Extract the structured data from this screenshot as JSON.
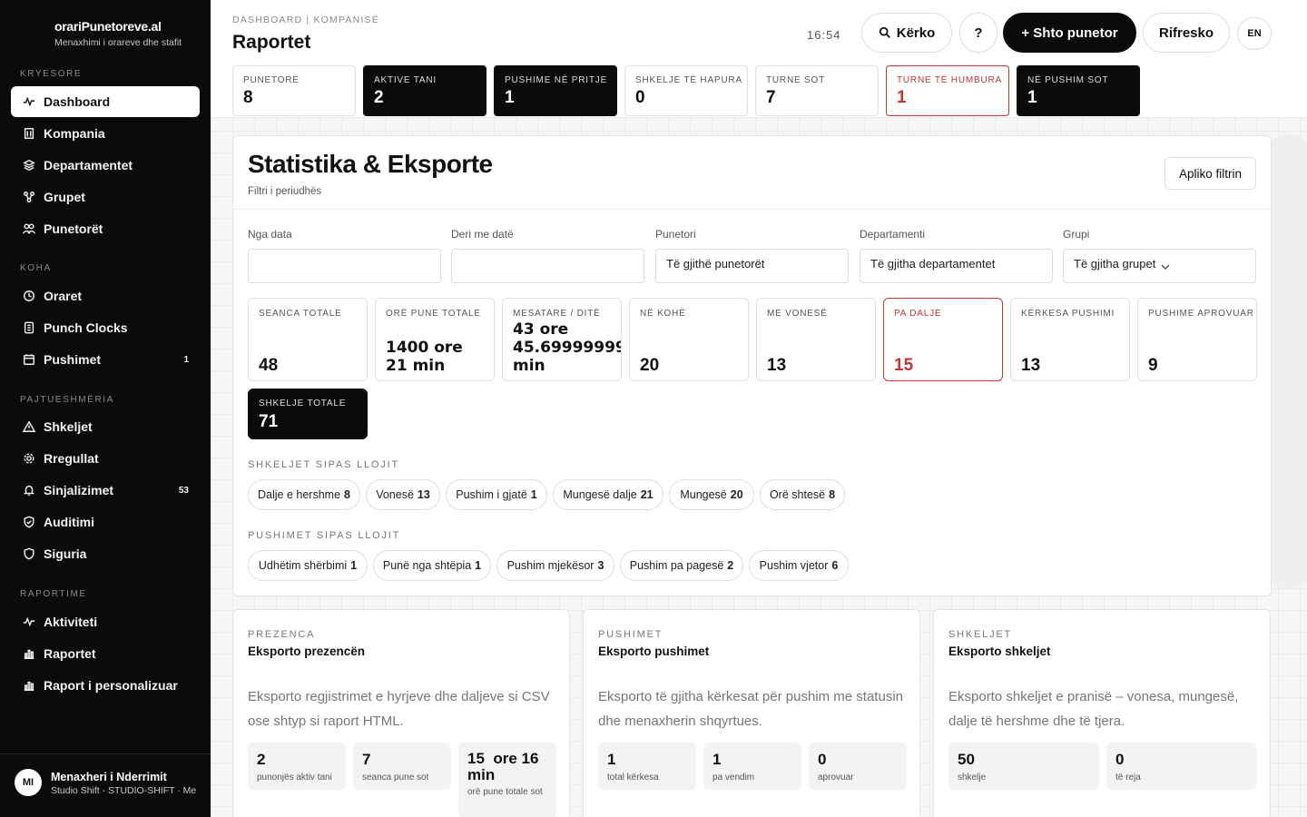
{
  "sidebar": {
    "brand": {
      "title": "orariPunetoreve.al",
      "subtitle": "Menaxhimi i orareve dhe stafit"
    },
    "sections": [
      {
        "label": "KRYESORE",
        "items": [
          {
            "label": "Dashboard",
            "icon": "activity-icon",
            "active": true
          },
          {
            "label": "Kompania",
            "icon": "building-icon"
          },
          {
            "label": "Departamentet",
            "icon": "layers-icon"
          },
          {
            "label": "Grupet",
            "icon": "group-icon"
          },
          {
            "label": "Punetorët",
            "icon": "users-icon"
          }
        ]
      },
      {
        "label": "KOHA",
        "items": [
          {
            "label": "Oraret",
            "icon": "clock-icon"
          },
          {
            "label": "Punch Clocks",
            "icon": "device-icon"
          },
          {
            "label": "Pushimet",
            "icon": "calendar-icon",
            "badge": "1"
          }
        ]
      },
      {
        "label": "PAJTUESHMËRIA",
        "items": [
          {
            "label": "Shkeljet",
            "icon": "warning-icon"
          },
          {
            "label": "Rregullat",
            "icon": "gear-icon"
          },
          {
            "label": "Sinjalizimet",
            "icon": "bell-icon",
            "badge": "53"
          },
          {
            "label": "Auditimi",
            "icon": "shield-icon"
          },
          {
            "label": "Siguria",
            "icon": "shield-lock-icon"
          }
        ]
      },
      {
        "label": "RAPORTIME",
        "items": [
          {
            "label": "Aktiviteti",
            "icon": "activity-icon"
          },
          {
            "label": "Raportet",
            "icon": "bar-chart-icon"
          },
          {
            "label": "Raport i personalizuar",
            "icon": "bar-chart-icon"
          }
        ]
      }
    ],
    "user": {
      "initials": "MI",
      "name": "Menaxheri i Nderrimit",
      "org": "Studio Shift - STUDIO-SHIFT · Me"
    }
  },
  "header": {
    "breadcrumb": "DASHBOARD  |  KOMPANISË",
    "title": "Raportet",
    "clock": "16:54",
    "search_label": "Kërko",
    "help_label": "?",
    "add_label": "+ Shto punetor",
    "refresh_label": "Rifresko",
    "lang_label": "EN"
  },
  "kpis": [
    {
      "label": "PUNETORE",
      "value": "8",
      "style": "light"
    },
    {
      "label": "AKTIVE TANI",
      "value": "2",
      "style": "dark"
    },
    {
      "label": "PUSHIME NË PRITJE",
      "value": "1",
      "style": "dark"
    },
    {
      "label": "SHKELJE TË HAPURA",
      "value": "0",
      "style": "light"
    },
    {
      "label": "TURNE SOT",
      "value": "7",
      "style": "light"
    },
    {
      "label": "TURNE TË HUMBURA",
      "value": "1",
      "style": "red"
    },
    {
      "label": "NË PUSHIM SOT",
      "value": "1",
      "style": "dark"
    }
  ],
  "stats_panel": {
    "title": "Statistika & Eksporte",
    "subtitle": "Filtri i periudhës",
    "apply_label": "Apliko filtrin",
    "filters": [
      {
        "label": "Nga data",
        "value": ""
      },
      {
        "label": "Deri me datë",
        "value": ""
      },
      {
        "label": "Punetori",
        "value": "Të gjithë punetorët"
      },
      {
        "label": "Departamenti",
        "value": "Të gjitha departamentet"
      },
      {
        "label": "Grupi",
        "value": "Të gjitha grupet"
      }
    ],
    "stats": [
      {
        "label": "SEANCA TOTALE",
        "value": "48"
      },
      {
        "label": "ORË PUNE TOTALE",
        "value": "1400 ore\n21 min"
      },
      {
        "label": "MESATARE / DITË",
        "value": "43 ore\n45.699999999\nmin"
      },
      {
        "label": "NË KOHË",
        "value": "20"
      },
      {
        "label": "ME VONESË",
        "value": "13"
      },
      {
        "label": "PA DALJE",
        "value": "15"
      },
      {
        "label": "KËRKESA PUSHIMI",
        "value": "13"
      },
      {
        "label": "PUSHIME APROVUAR",
        "value": "9"
      },
      {
        "label": "SHKELJE TOTALE",
        "value": "71"
      }
    ],
    "violations_label": "SHKELJET SIPAS LLOJIT",
    "violations": [
      {
        "name": "Dalje e hershme",
        "count": "8"
      },
      {
        "name": "Vonesë",
        "count": "13"
      },
      {
        "name": "Pushim i gjatë",
        "count": "1"
      },
      {
        "name": "Mungesë dalje",
        "count": "21"
      },
      {
        "name": "Mungesë",
        "count": "20"
      },
      {
        "name": "Orë shtesë",
        "count": "8"
      }
    ],
    "leaves_label": "PUSHIMET SIPAS LLOJIT",
    "leaves": [
      {
        "name": "Udhëtim shërbimi",
        "count": "1"
      },
      {
        "name": "Punë nga shtëpia",
        "count": "1"
      },
      {
        "name": "Pushim mjekësor",
        "count": "3"
      },
      {
        "name": "Pushim pa pagesë",
        "count": "2"
      },
      {
        "name": "Pushim vjetor",
        "count": "6"
      }
    ]
  },
  "export_cards": [
    {
      "label": "PREZENCA",
      "title": "Eksporto prezencën",
      "desc": "Eksporto regjistrimet e hyrjeve dhe daljeve si CSV ose shtyp si raport HTML.",
      "minis": [
        {
          "value": "2",
          "label": "punonjës aktiv tani"
        },
        {
          "value": "7",
          "label": "seanca pune sot"
        },
        {
          "value": "15  ore 16\nmin",
          "label": "orë pune totale sot"
        }
      ]
    },
    {
      "label": "PUSHIMET",
      "title": "Eksporto pushimet",
      "desc": "Eksporto të gjitha kërkesat për pushim me statusin dhe menaxherin shqyrtues.",
      "minis": [
        {
          "value": "1",
          "label": "total kërkesa"
        },
        {
          "value": "1",
          "label": "pa vendim"
        },
        {
          "value": "0",
          "label": "aprovuar"
        }
      ]
    },
    {
      "label": "SHKELJET",
      "title": "Eksporto shkeljet",
      "desc": "Eksporto shkeljet e pranisë – vonesa, mungesë, dalje të hershme dhe të tjera.",
      "minis": [
        {
          "value": "50",
          "label": "shkelje"
        },
        {
          "value": "0",
          "label": "të reja"
        }
      ]
    }
  ]
}
